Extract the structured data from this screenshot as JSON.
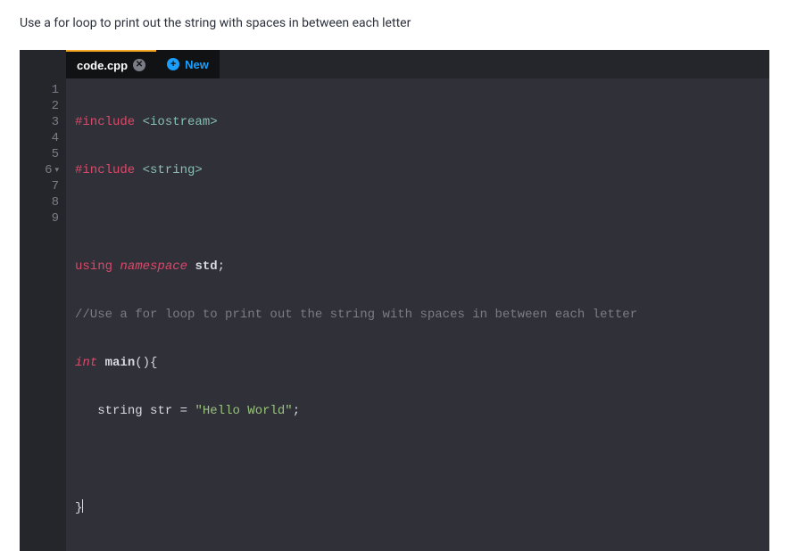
{
  "instruction": "Use a for loop to print out the string with spaces in between each letter",
  "tabs": {
    "active": {
      "label": "code.cpp"
    },
    "new": {
      "label": "New"
    }
  },
  "gutter": {
    "lines": [
      "1",
      "2",
      "3",
      "4",
      "5",
      "6",
      "7",
      "8",
      "9"
    ],
    "foldLine": 6
  },
  "code": {
    "l1": {
      "preproc": "#include",
      "angle": "<iostream>"
    },
    "l2": {
      "preproc": "#include",
      "angle": "<string>"
    },
    "l4": {
      "kw1": "using",
      "kw2": "namespace",
      "ns": "std",
      "semi": ";"
    },
    "l5": {
      "comment": "//Use a for loop to print out the string with spaces in between each letter"
    },
    "l6": {
      "type": "int",
      "func": "main",
      "rest": "(){"
    },
    "l7": {
      "indent": "   ",
      "type": "string",
      "ident": "str",
      "op": " = ",
      "str": "\"Hello World\"",
      "semi": ";"
    },
    "l9": {
      "brace": "}"
    }
  }
}
